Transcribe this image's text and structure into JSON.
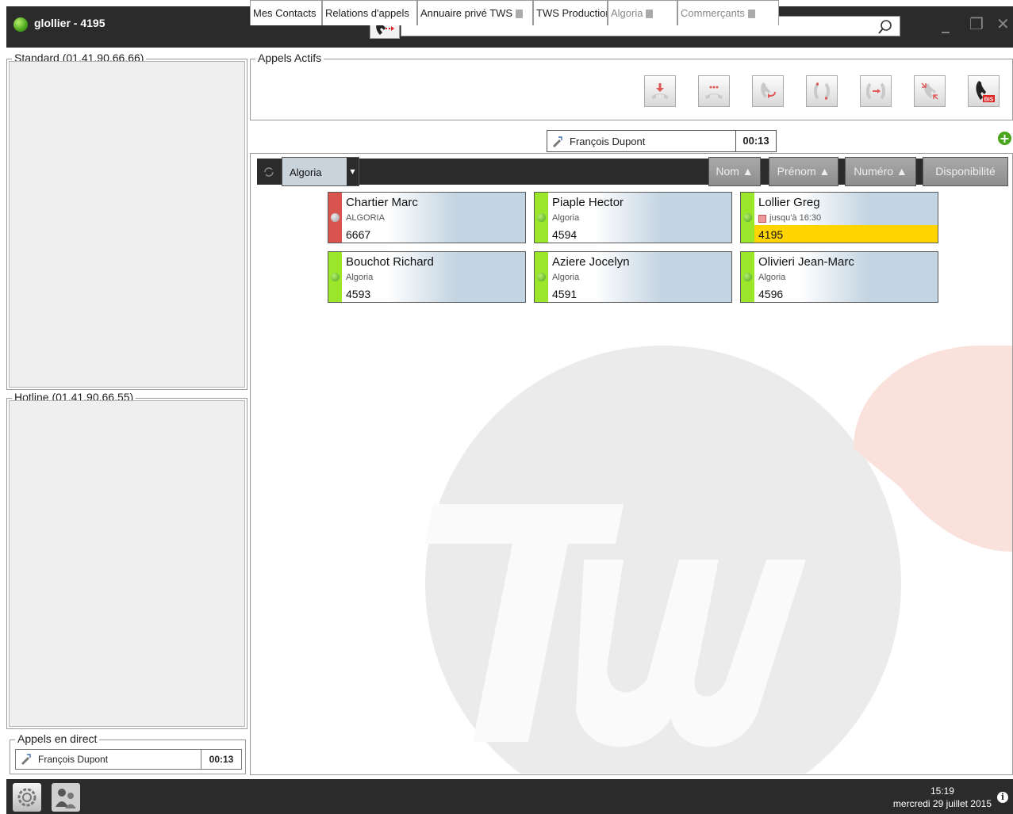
{
  "window": {
    "title": "glollier - 4195",
    "status_color": "#4aa51c",
    "minimize_icon": "_",
    "restore_icon": "❐",
    "close_icon": "✕"
  },
  "search": {
    "value": "",
    "placeholder": ""
  },
  "panels": {
    "standard_label": "Standard (01.41.90.66.66)",
    "hotline_label": "Hotline (01.41.90.66.55)",
    "direct_label": "Appels en direct",
    "active_label": "Appels Actifs"
  },
  "direct_call": {
    "name": "François Dupont",
    "duration": "00:13"
  },
  "call_actions": [
    {
      "icon": "pickup-icon"
    },
    {
      "icon": "hold-icon"
    },
    {
      "icon": "transfer-icon"
    },
    {
      "icon": "conference-icon"
    },
    {
      "icon": "attended-transfer-icon"
    },
    {
      "icon": "hangup-icon"
    },
    {
      "icon": "redial-bis-icon",
      "badge": "BIS"
    }
  ],
  "tabs": [
    {
      "label": "Mes Contacts"
    },
    {
      "label": "Relations d'appels"
    },
    {
      "label": "Annuaire privé TWS"
    },
    {
      "label": "TWS Production"
    },
    {
      "label": "Algoria"
    },
    {
      "label": "Commerçants"
    }
  ],
  "drag_ghost": {
    "name": "François Dupont",
    "duration": "00:13"
  },
  "filter": {
    "selected": "Algoria",
    "sort_buttons": [
      {
        "label": "Nom ▲"
      },
      {
        "label": "Prénom ▲"
      },
      {
        "label": "Numéro ▲"
      },
      {
        "label": "Disponibilité"
      }
    ]
  },
  "contacts": [
    {
      "name": "Chartier Marc",
      "company": "ALGORIA",
      "number": "6667",
      "status": "busy",
      "strip_color": "#d9534f"
    },
    {
      "name": "Piaple Hector",
      "company": "Algoria",
      "number": "4594",
      "status": "available",
      "strip_color": "#9be62a"
    },
    {
      "name": "Lollier Greg",
      "company": "jusqu'à 16:30",
      "number": "4195",
      "status": "available",
      "strip_color": "#9be62a",
      "highlight": "#ffd400"
    },
    {
      "name": "Bouchot Richard",
      "company": "Algoria",
      "number": "4593",
      "status": "available",
      "strip_color": "#9be62a"
    },
    {
      "name": "Aziere Jocelyn",
      "company": "Algoria",
      "number": "4591",
      "status": "available",
      "strip_color": "#9be62a"
    },
    {
      "name": "Olivieri Jean-Marc",
      "company": "Algoria",
      "number": "4596",
      "status": "available",
      "strip_color": "#9be62a"
    }
  ],
  "footer": {
    "time": "15:19",
    "date": "mercredi 29 juillet 2015"
  }
}
